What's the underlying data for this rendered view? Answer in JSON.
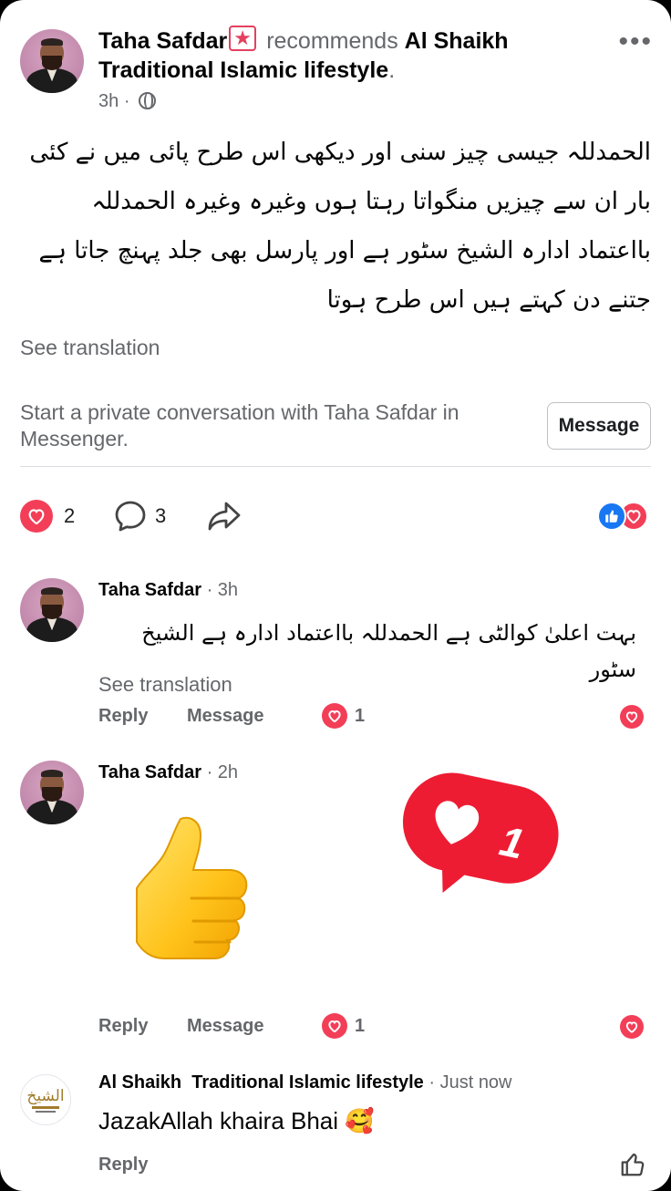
{
  "post": {
    "author": "Taha Safdar",
    "verb": "recommends",
    "page": "Al Shaikh Traditional Islamic lifestyle",
    "time": "3h",
    "time_sep": "·",
    "body": "الحمدللہ جیسی چیز سنی اور دیکھی اس طرح پائی میں نے کئی بار ان سے  چیزیں منگواتا رہتا ہوں وغیرہ وغیرہ الحمدللہ بااعتماد ادارہ الشیخ سٹور ہے اور پارسل بھی جلد پہنچ جاتا ہے جتنے دن کہتے ہیں اس طرح ہوتا",
    "see_translation": "See translation",
    "private_conversation": "Start a private conversation with Taha Safdar in Messenger.",
    "message_button": "Message",
    "like_count": "2",
    "comment_count": "3"
  },
  "comments": [
    {
      "author": "Taha Safdar",
      "time": "· 3h",
      "text": "بہت اعلیٰ کوالٹی ہے الحمدللہ بااعتماد ادارہ ہے الشیخ سٹور",
      "see_translation": "See translation",
      "reply": "Reply",
      "message": "Message",
      "reactions": "1"
    },
    {
      "author": "Taha Safdar",
      "time": "· 2h",
      "sticker": "thumbs-up",
      "bubble_count": "1",
      "reply": "Reply",
      "message": "Message",
      "reactions": "1"
    },
    {
      "author": "Al Shaikh  Traditional Islamic lifestyle",
      "time": "· Just now",
      "text": "JazakAllah khaira Bhai 🥰",
      "reply": "Reply"
    }
  ],
  "colors": {
    "heart": "#f33e58",
    "like_blue": "#1877f2",
    "muted": "#65676b",
    "bubble_red": "#ed1c33"
  }
}
